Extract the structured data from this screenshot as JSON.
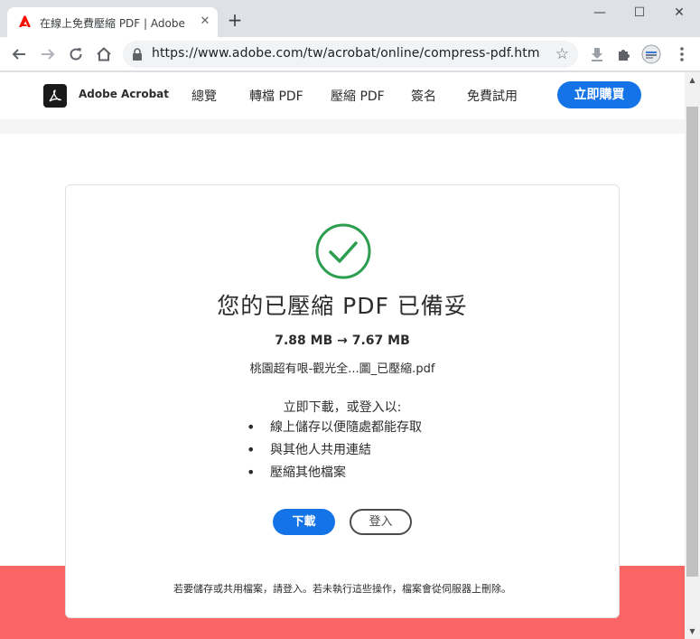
{
  "browser": {
    "tab_title": "在線上免費壓縮 PDF | Adobe Acrobat",
    "tab_close": "✕",
    "new_tab": "+",
    "url": "https://www.adobe.com/tw/acrobat/online/compress-pdf.html?pr...",
    "window_controls": {
      "minimize": "—",
      "maximize": "☐",
      "close": "✕"
    }
  },
  "nav": {
    "brand": "Adobe Acrobat",
    "links": [
      "總覽",
      "轉檔 PDF",
      "壓縮 PDF",
      "簽名",
      "免費試用"
    ],
    "buy_label": "立即購買"
  },
  "result": {
    "heading": "您的已壓縮 PDF 已備妥",
    "sizes": "7.88 MB → 7.67 MB",
    "filename": "桃園超有哏-觀光全...圖_已壓縮.pdf",
    "intro": "立即下載，或登入以:",
    "bullets": [
      "線上儲存以便隨處都能存取",
      "與其他人共用連結",
      "壓縮其他檔案"
    ],
    "download_label": "下載",
    "login_label": "登入",
    "footnote": "若要儲存或共用檔案，請登入。若未執行這些操作，檔案會從伺服器上刪除。"
  },
  "colors": {
    "accent_blue": "#1473e6",
    "success_green": "#2d9d4f",
    "band_red": "#fa6566"
  }
}
